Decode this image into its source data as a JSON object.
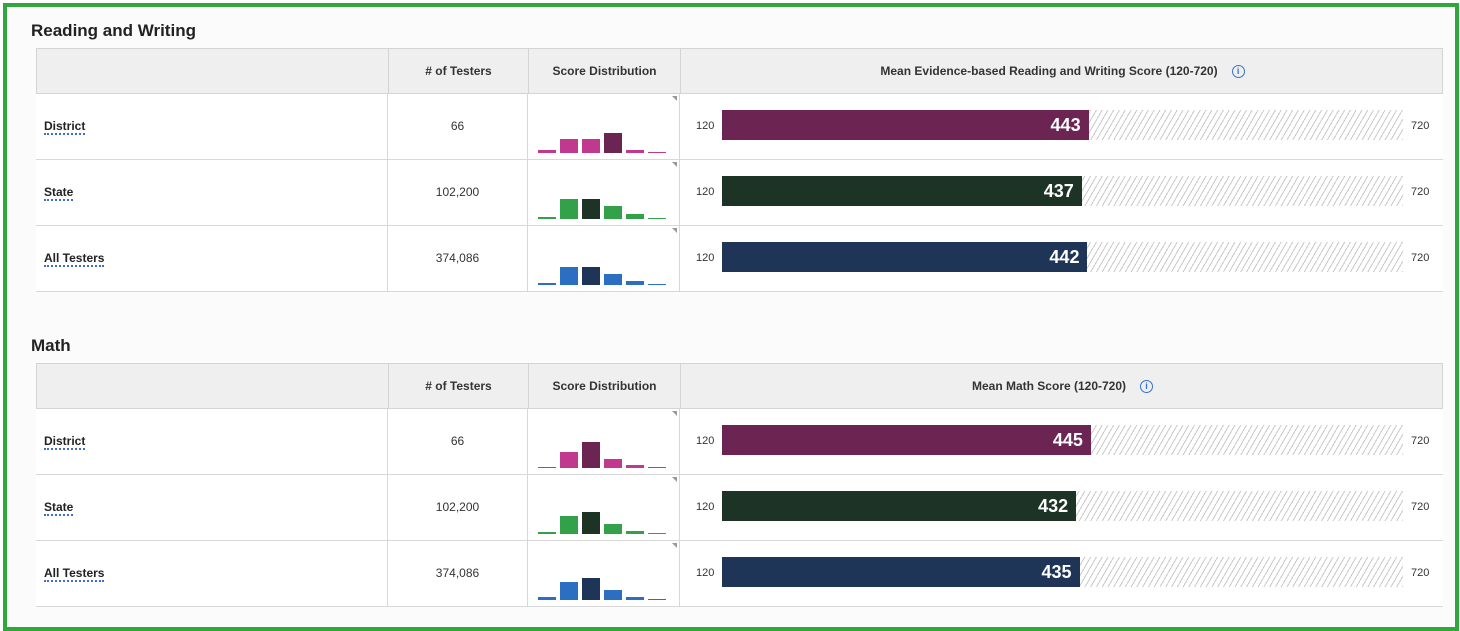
{
  "colors": {
    "frame": "#2fa73c",
    "district": "#6c2452",
    "district_light": "#c0398e",
    "state": "#1d3325",
    "state_light": "#33a04a",
    "all": "#1f3557",
    "all_light": "#2c6fc2",
    "hatch": "#c9c9c9"
  },
  "columns": {
    "testers": "# of Testers",
    "distribution": "Score Distribution"
  },
  "reading": {
    "title": "Reading and Writing",
    "mean_header": "Mean Evidence-based Reading and Writing Score (120-720)",
    "info_icon": "i",
    "rows": [
      {
        "label": "District",
        "testers": "66",
        "min": "120",
        "max": "720",
        "score": "443",
        "distribution": [
          0.1,
          0.45,
          0.45,
          0.62,
          0.1,
          0.04
        ]
      },
      {
        "label": "State",
        "testers": "102,200",
        "min": "120",
        "max": "720",
        "score": "437",
        "distribution": [
          0.07,
          0.62,
          0.62,
          0.4,
          0.15,
          0.03
        ]
      },
      {
        "label": "All Testers",
        "testers": "374,086",
        "min": "120",
        "max": "720",
        "score": "442",
        "distribution": [
          0.07,
          0.55,
          0.55,
          0.35,
          0.12,
          0.03
        ]
      }
    ]
  },
  "math": {
    "title": "Math",
    "mean_header": "Mean Math Score (120-720)",
    "info_icon": "i",
    "rows": [
      {
        "label": "District",
        "testers": "66",
        "min": "120",
        "max": "720",
        "score": "445",
        "distribution": [
          0.04,
          0.5,
          0.8,
          0.28,
          0.1,
          0.04
        ]
      },
      {
        "label": "State",
        "testers": "102,200",
        "min": "120",
        "max": "720",
        "score": "432",
        "distribution": [
          0.07,
          0.55,
          0.7,
          0.3,
          0.08,
          0.03
        ]
      },
      {
        "label": "All Testers",
        "testers": "374,086",
        "min": "120",
        "max": "720",
        "score": "435",
        "distribution": [
          0.08,
          0.55,
          0.7,
          0.3,
          0.08,
          0.03
        ]
      }
    ]
  }
}
